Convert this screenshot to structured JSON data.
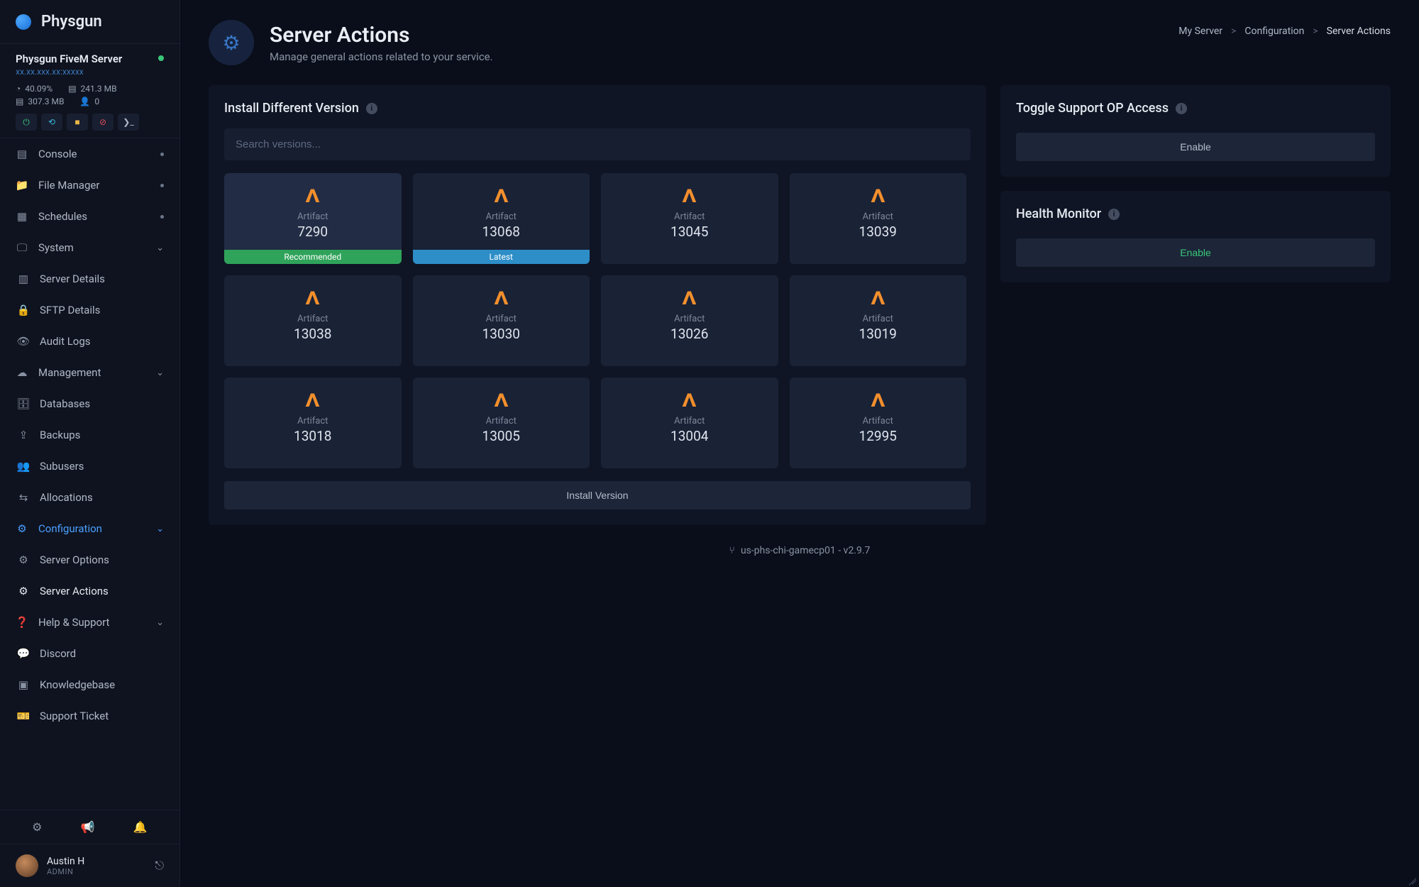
{
  "brand": "Physgun",
  "server": {
    "name": "Physgun FiveM Server",
    "ip": "xx.xx.xxx.xx:xxxxx",
    "cpu": "40.09%",
    "ram": "241.3 MB",
    "disk": "307.3 MB",
    "players": "0"
  },
  "nav": {
    "console": "Console",
    "file_manager": "File Manager",
    "schedules": "Schedules",
    "system": "System",
    "server_details": "Server Details",
    "sftp_details": "SFTP Details",
    "audit_logs": "Audit Logs",
    "management": "Management",
    "databases": "Databases",
    "backups": "Backups",
    "subusers": "Subusers",
    "allocations": "Allocations",
    "configuration": "Configuration",
    "server_options": "Server Options",
    "server_actions": "Server Actions",
    "help_support": "Help & Support",
    "discord": "Discord",
    "knowledgebase": "Knowledgebase",
    "support_ticket": "Support Ticket"
  },
  "user": {
    "name": "Austin H",
    "role": "ADMIN"
  },
  "page": {
    "title": "Server Actions",
    "subtitle": "Manage general actions related to your service."
  },
  "breadcrumb": {
    "a": "My Server",
    "b": "Configuration",
    "c": "Server Actions"
  },
  "install_panel": {
    "title": "Install Different Version",
    "search_placeholder": "Search versions...",
    "artifact_label": "Artifact",
    "install_button": "Install Version",
    "recommended": "Recommended",
    "latest": "Latest"
  },
  "versions": [
    {
      "num": "7290",
      "badge": "rec"
    },
    {
      "num": "13068",
      "badge": "lat"
    },
    {
      "num": "13045",
      "badge": ""
    },
    {
      "num": "13039",
      "badge": ""
    },
    {
      "num": "13038",
      "badge": ""
    },
    {
      "num": "13030",
      "badge": ""
    },
    {
      "num": "13026",
      "badge": ""
    },
    {
      "num": "13019",
      "badge": ""
    },
    {
      "num": "13018",
      "badge": ""
    },
    {
      "num": "13005",
      "badge": ""
    },
    {
      "num": "13004",
      "badge": ""
    },
    {
      "num": "12995",
      "badge": ""
    }
  ],
  "support_panel": {
    "title": "Toggle Support OP Access",
    "button": "Enable"
  },
  "health_panel": {
    "title": "Health Monitor",
    "button": "Enable"
  },
  "footer_note": "us-phs-chi-gamecp01 - v2.9.7"
}
